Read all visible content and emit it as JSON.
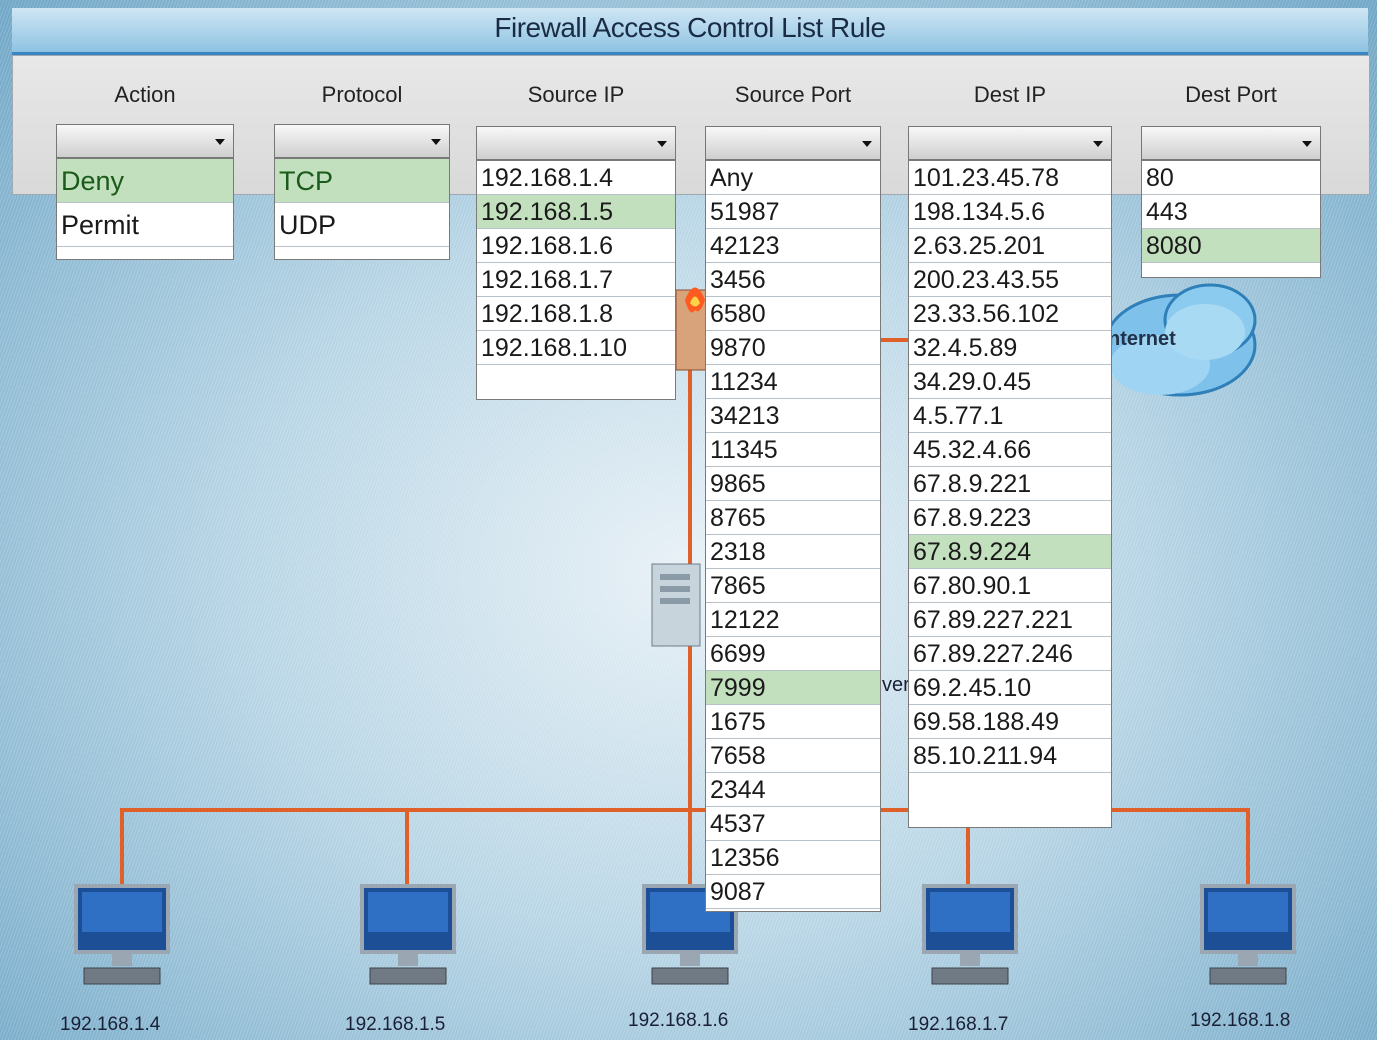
{
  "window": {
    "title": "Firewall Access Control List Rule"
  },
  "columns": {
    "action": {
      "title": "Action",
      "options": [
        {
          "label": "Deny",
          "selected": true
        },
        {
          "label": "Permit",
          "selected": false
        }
      ]
    },
    "protocol": {
      "title": "Protocol",
      "options": [
        {
          "label": "TCP",
          "selected": true
        },
        {
          "label": "UDP",
          "selected": false
        }
      ]
    },
    "source_ip": {
      "title": "Source IP",
      "options": [
        {
          "label": "192.168.1.4",
          "selected": false
        },
        {
          "label": "192.168.1.5",
          "selected": true
        },
        {
          "label": "192.168.1.6",
          "selected": false
        },
        {
          "label": "192.168.1.7",
          "selected": false
        },
        {
          "label": "192.168.1.8",
          "selected": false
        },
        {
          "label": "192.168.1.10",
          "selected": false
        }
      ]
    },
    "source_port": {
      "title": "Source Port",
      "options": [
        {
          "label": "Any",
          "selected": false
        },
        {
          "label": "51987",
          "selected": false
        },
        {
          "label": "42123",
          "selected": false
        },
        {
          "label": "3456",
          "selected": false
        },
        {
          "label": "6580",
          "selected": false
        },
        {
          "label": "9870",
          "selected": false
        },
        {
          "label": "11234",
          "selected": false
        },
        {
          "label": "34213",
          "selected": false
        },
        {
          "label": "11345",
          "selected": false
        },
        {
          "label": "9865",
          "selected": false
        },
        {
          "label": "8765",
          "selected": false
        },
        {
          "label": "2318",
          "selected": false
        },
        {
          "label": "7865",
          "selected": false
        },
        {
          "label": "12122",
          "selected": false
        },
        {
          "label": "6699",
          "selected": false
        },
        {
          "label": "7999",
          "selected": true
        },
        {
          "label": "1675",
          "selected": false
        },
        {
          "label": "7658",
          "selected": false
        },
        {
          "label": "2344",
          "selected": false
        },
        {
          "label": "4537",
          "selected": false
        },
        {
          "label": "12356",
          "selected": false
        },
        {
          "label": "9087",
          "selected": false
        }
      ]
    },
    "dest_ip": {
      "title": "Dest IP",
      "options": [
        {
          "label": "101.23.45.78",
          "selected": false
        },
        {
          "label": "198.134.5.6",
          "selected": false
        },
        {
          "label": "2.63.25.201",
          "selected": false
        },
        {
          "label": "200.23.43.55",
          "selected": false
        },
        {
          "label": "23.33.56.102",
          "selected": false
        },
        {
          "label": "32.4.5.89",
          "selected": false
        },
        {
          "label": "34.29.0.45",
          "selected": false
        },
        {
          "label": "4.5.77.1",
          "selected": false
        },
        {
          "label": "45.32.4.66",
          "selected": false
        },
        {
          "label": "67.8.9.221",
          "selected": false
        },
        {
          "label": "67.8.9.223",
          "selected": false
        },
        {
          "label": "67.8.9.224",
          "selected": true
        },
        {
          "label": "67.80.90.1",
          "selected": false
        },
        {
          "label": "67.89.227.221",
          "selected": false
        },
        {
          "label": "67.89.227.246",
          "selected": false
        },
        {
          "label": "69.2.45.10",
          "selected": false
        },
        {
          "label": "69.58.188.49",
          "selected": false
        },
        {
          "label": "85.10.211.94",
          "selected": false
        }
      ]
    },
    "dest_port": {
      "title": "Dest Port",
      "options": [
        {
          "label": "80",
          "selected": false
        },
        {
          "label": "443",
          "selected": false
        },
        {
          "label": "8080",
          "selected": true
        }
      ]
    }
  },
  "network": {
    "cloud_label": "nternet",
    "partial_label": "ver",
    "computers": [
      "192.168.1.4",
      "192.168.1.5",
      "192.168.1.6",
      "192.168.1.7",
      "192.168.1.8"
    ]
  },
  "colors": {
    "selected_bg": "#c2e0bd",
    "wire": "#e0602a",
    "title_bar": "#8fc3e2"
  }
}
